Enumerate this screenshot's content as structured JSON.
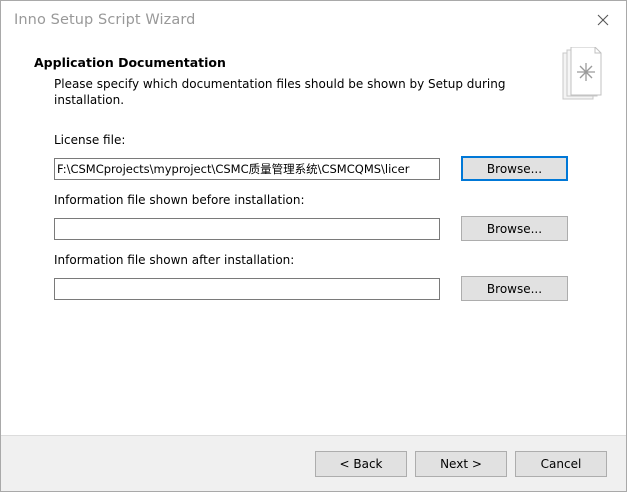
{
  "window": {
    "title": "Inno Setup Script Wizard"
  },
  "header": {
    "heading": "Application Documentation",
    "description": "Please specify which documentation files should be shown by Setup during installation."
  },
  "fields": [
    {
      "label": "License file:",
      "value": "F:\\CSMCprojects\\myproject\\CSMC质量管理系统\\CSMCQMS\\licer",
      "browse_label": "Browse..."
    },
    {
      "label": "Information file shown before installation:",
      "value": "",
      "browse_label": "Browse..."
    },
    {
      "label": "Information file shown after installation:",
      "value": "",
      "browse_label": "Browse..."
    }
  ],
  "footer": {
    "back_label": "< Back",
    "next_label": "Next >",
    "cancel_label": "Cancel"
  },
  "icons": {
    "close": "close-icon",
    "wizard": "documents-wizard-icon"
  },
  "colors": {
    "accent": "#0078d7",
    "footer_bg": "#f0f0f0",
    "button_bg": "#e1e1e1"
  }
}
